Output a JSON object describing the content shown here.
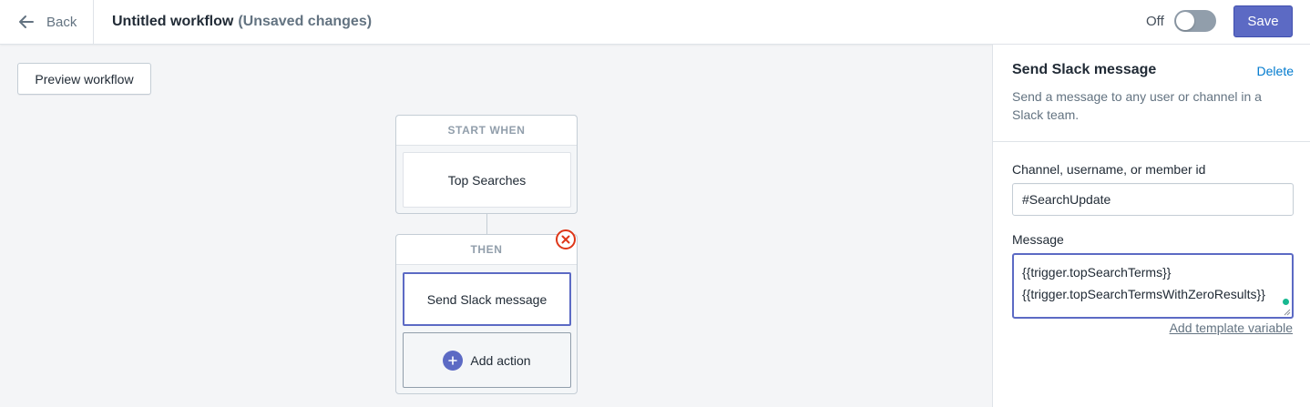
{
  "header": {
    "back_label": "Back",
    "title": "Untitled workflow",
    "unsaved_label": "(Unsaved changes)",
    "toggle_label": "Off",
    "toggle_on": false,
    "save_label": "Save"
  },
  "canvas": {
    "preview_label": "Preview workflow",
    "start_group": {
      "header": "START WHEN",
      "trigger_label": "Top Searches"
    },
    "then_group": {
      "header": "THEN",
      "action_label": "Send Slack message",
      "add_action_label": "Add action"
    }
  },
  "panel": {
    "title": "Send Slack message",
    "delete_label": "Delete",
    "description": "Send a message to any user or channel in a Slack team.",
    "channel_label": "Channel, username, or member id",
    "channel_value": "#SearchUpdate",
    "message_label": "Message",
    "message_value": "{{trigger.topSearchTerms}}\n{{trigger.topSearchTermsWithZeroResults}}",
    "add_variable_label": "Add template variable"
  },
  "colors": {
    "accent": "#5c6ac4",
    "error": "#de3618",
    "link": "#007ace",
    "status_ok": "#17b890"
  }
}
